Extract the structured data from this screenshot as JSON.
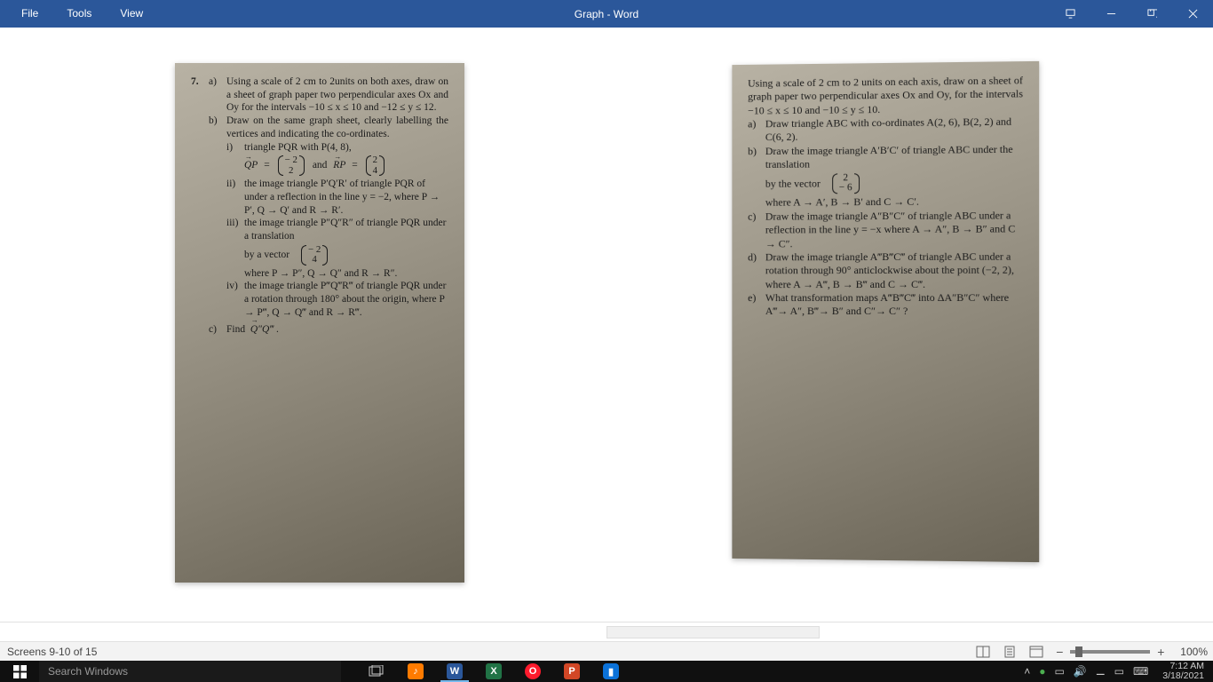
{
  "titlebar": {
    "menus": [
      "File",
      "Tools",
      "View"
    ],
    "title": "Graph  -  Word"
  },
  "nav": {
    "prev": "◀",
    "next": "▶"
  },
  "page_left": {
    "q_num": "7.",
    "a_label": "a)",
    "a_text": "Using a scale of 2 cm to 2units on both axes, draw on a sheet of graph paper two perpendicular axes Ox and Oy for the intervals −10 ≤ x ≤ 10 and −12 ≤ y ≤ 12.",
    "b_label": "b)",
    "b_text": "Draw on the same graph sheet, clearly labelling the vertices and indicating the co-ordinates.",
    "bi_label": "i)",
    "bi_text": "triangle PQR with P(4, 8),",
    "bi_math_lhs": "QP  =",
    "bi_mat1_top": "− 2",
    "bi_mat1_bot": "2",
    "bi_math_mid": " and  RP  =",
    "bi_mat2_top": "2",
    "bi_mat2_bot": "4",
    "bii_label": "ii)",
    "bii_text": "the image triangle P′Q′R′ of triangle PQR of under a reflection in the line y = −2, where P → P′,  Q → Q′ and R → R′.",
    "biii_label": "iii)",
    "biii_text": "the image triangle P″Q″R″ of triangle PQR under a translation",
    "biii_by": "by a vector",
    "biii_mat_top": "− 2",
    "biii_mat_bot": "4",
    "biii_tail": "where P →  P″,  Q →  Q″ and R →  R″.",
    "biv_label": "iv)",
    "biv_text": "the image triangle P‴Q‴R‴ of triangle PQR under a rotation through 180° about the   origin, where P → P‴,  Q → Q‴ and R → R‴.",
    "c_label": "c)",
    "c_text": "Find  Q″Q‴ ."
  },
  "page_right": {
    "intro": "Using a scale of 2 cm to 2 units on each axis, draw on a sheet of graph paper two perpendicular axes Ox and Oy, for the intervals −10 ≤ x ≤ 10 and −10 ≤ y ≤ 10.",
    "a_label": "a)",
    "a_text": "Draw triangle ABC with co-ordinates A(2, 6), B(2, 2) and C(6, 2).",
    "b_label": "b)",
    "b_text": "Draw the image triangle A′B′C′ of triangle ABC under the translation",
    "b_by": "by the vector",
    "b_mat_top": "2",
    "b_mat_bot": "− 6",
    "b_tail": "where A → A′,  B → B′ and C → C′.",
    "c_label": "c)",
    "c_text": "Draw the image triangle A″B″C″ of triangle ABC under a reflection in the line y = −x   where A → A″, B → B″ and C → C″.",
    "d_label": "d)",
    "d_text": "Draw the image triangle A‴B‴C‴ of triangle ABC under a rotation through 90° anticlockwise about the point (−2, 2), where A → A‴, B → B‴ and C → C‴.",
    "e_label": "e)",
    "e_text": "What transformation maps A‴B‴C‴ into ΔA″B″C″ where A‴→  A″,  B‴→ B″ and C″→  C″ ?"
  },
  "statusbar": {
    "screens": "Screens 9-10 of 15",
    "zoom_minus": "−",
    "zoom_plus": "+",
    "zoom_value": "100%"
  },
  "taskbar": {
    "search_placeholder": "Search Windows",
    "apps": [
      {
        "name": "task-view",
        "bg": "transparent",
        "glyph": "▭"
      },
      {
        "name": "music-app",
        "bg": "#ff7b00",
        "glyph": "♪"
      },
      {
        "name": "word-app",
        "bg": "#2b579a",
        "glyph": "W",
        "active": true
      },
      {
        "name": "excel-app",
        "bg": "#217346",
        "glyph": "X"
      },
      {
        "name": "opera-app",
        "bg": "#ff1b2d",
        "glyph": "O"
      },
      {
        "name": "powerpoint-app",
        "bg": "#d24726",
        "glyph": "P"
      },
      {
        "name": "meet-app",
        "bg": "#00897b",
        "glyph": "▮"
      }
    ],
    "time": "7:12 AM",
    "date": "3/18/2021"
  }
}
